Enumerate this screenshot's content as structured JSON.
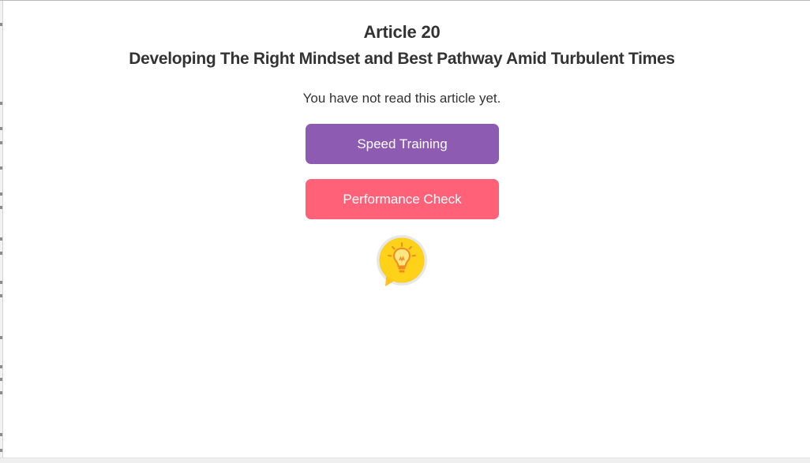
{
  "article": {
    "number_label": "Article 20",
    "title": "Developing The Right Mindset and Best Pathway Amid Turbulent Times",
    "read_status": "You have not read this article yet."
  },
  "actions": {
    "speed_training_label": "Speed Training",
    "performance_check_label": "Performance Check"
  },
  "hint": {
    "icon": "lightbulb-speech-bubble-icon"
  },
  "colors": {
    "text": "#333333",
    "speed_training": "#8d5bb1",
    "performance_check": "#ff6178",
    "hint_bubble": "#ffd21a",
    "hint_bulb": "#f08a24"
  }
}
